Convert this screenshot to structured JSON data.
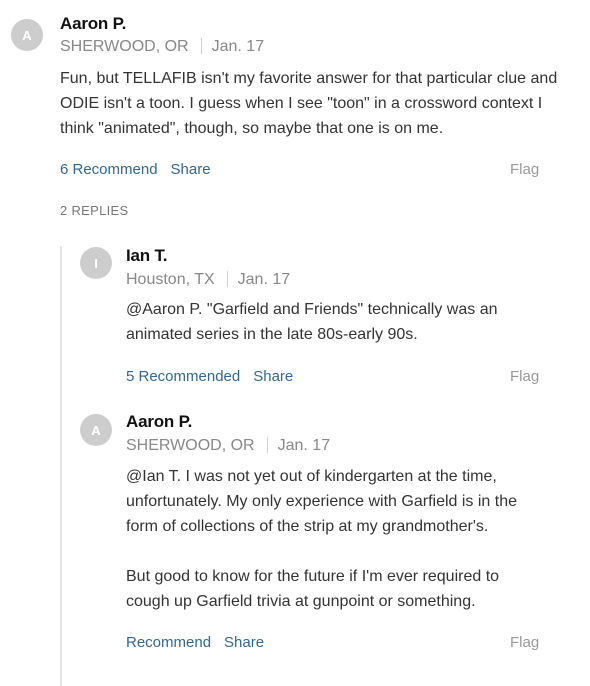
{
  "comments": [
    {
      "avatar_initial": "A",
      "author": "Aaron P.",
      "location": "SHERWOOD, OR",
      "date": "Jan. 17",
      "body": [
        "Fun, but TELLAFIB isn't my favorite answer for that particular clue and ODIE isn't a toon. I guess when I see \"toon\" in a crossword context I think \"animated\", though, so maybe that one is on me."
      ],
      "recommend_label": "6 Recommend",
      "share_label": "Share",
      "flag_label": "Flag"
    }
  ],
  "replies_label": "2 REPLIES",
  "replies": [
    {
      "avatar_initial": "I",
      "author": "Ian T.",
      "location": "Houston, TX",
      "date": "Jan. 17",
      "body": [
        "@Aaron P. \"Garfield and Friends\" technically was an animated series in the late 80s-early 90s."
      ],
      "recommend_label": "5 Recommended",
      "share_label": "Share",
      "flag_label": "Flag"
    },
    {
      "avatar_initial": "A",
      "author": "Aaron P.",
      "location": "SHERWOOD, OR",
      "date": "Jan. 17",
      "body": [
        "@Ian T. I was not yet out of kindergarten at the time, unfortunately. My only experience with Garfield is in the form of collections of the strip at my grandmother's.",
        "But good to know for the future if I'm ever required to cough up Garfield trivia at gunpoint or something."
      ],
      "recommend_label": "Recommend",
      "share_label": "Share",
      "flag_label": "Flag"
    }
  ]
}
